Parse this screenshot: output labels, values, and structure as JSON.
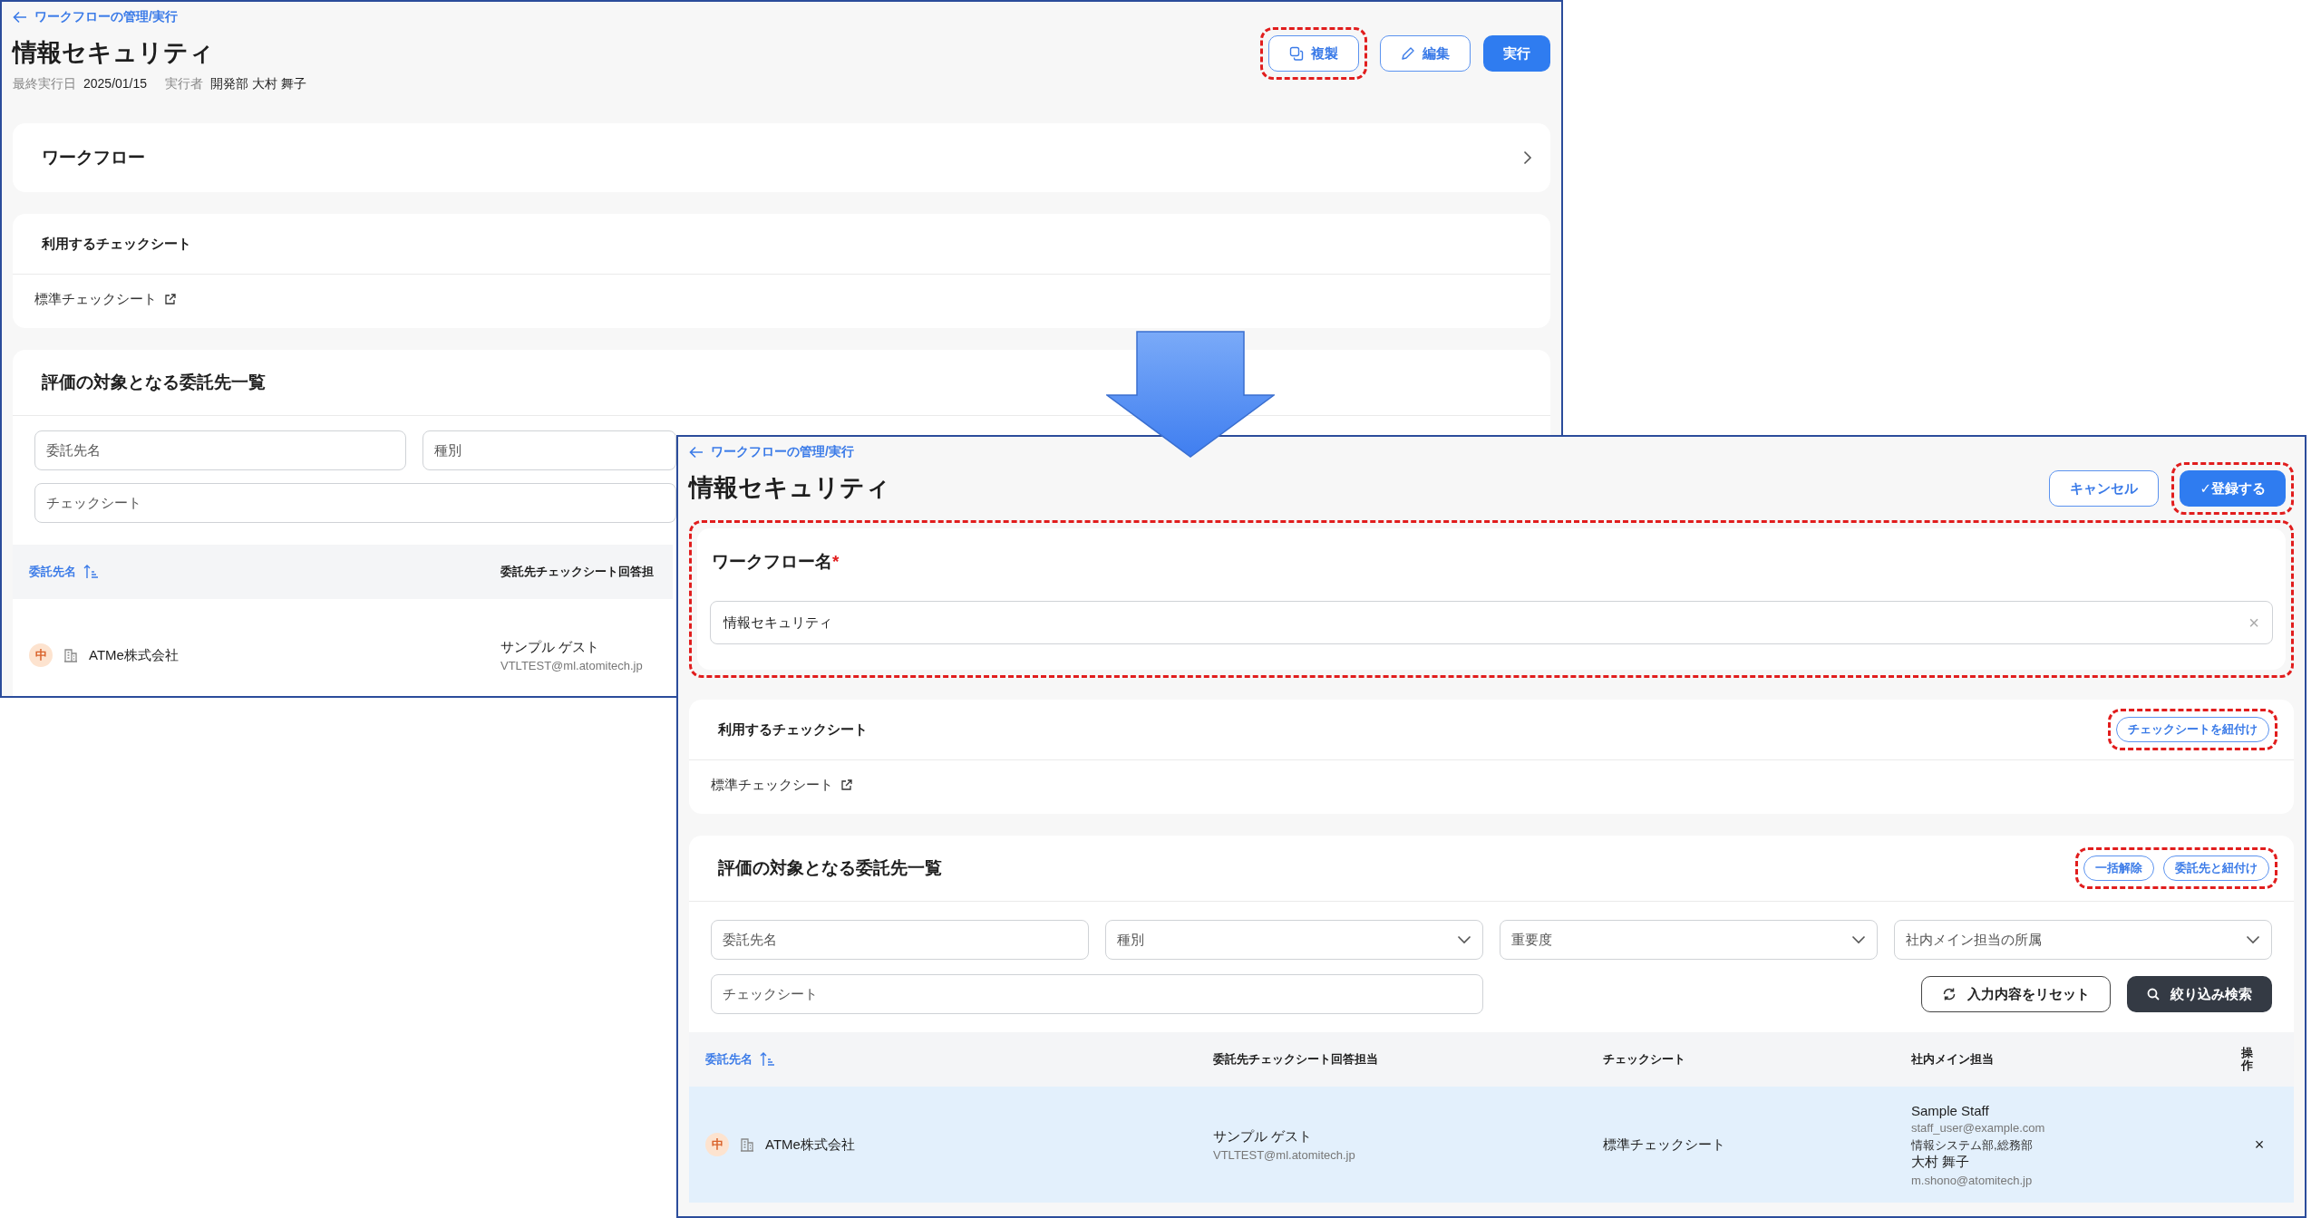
{
  "original_screen": {
    "breadcrumb": "ワークフローの管理/実行",
    "title": "情報セキュリティ",
    "meta": [
      {
        "label": "最終実行日",
        "value": "2025/01/15"
      },
      {
        "label": "実行者",
        "value": "開発部 大村 舞子"
      }
    ],
    "buttons": [
      {
        "label": "複製",
        "kind": "duplicate",
        "highlighted": true
      },
      {
        "label": "編集",
        "kind": "edit",
        "highlighted": false
      },
      {
        "label": "実行",
        "kind": "run",
        "highlighted": false
      }
    ],
    "workflow_section": {
      "title": "ワークフロー"
    },
    "checksheet_section": {
      "title": "利用するチェックシート",
      "link": "標準チェックシート"
    },
    "entrustee_section": {
      "title": "評価の対象となる委託先一覧",
      "filters": [
        {
          "placeholder": "委託先名",
          "kind": "text"
        },
        {
          "placeholder": "種別",
          "kind": "text"
        },
        {
          "placeholder": "チェックシート",
          "kind": "wide"
        }
      ],
      "table": {
        "columns": [
          {
            "label": "委託先名",
            "sorted": true
          },
          {
            "label": "委託先チェックシート回答担",
            "sorted": false
          }
        ],
        "rows": [
          {
            "selected": false,
            "priority": "中",
            "name": "ATMe株式会社",
            "responder": "サンプル ゲスト",
            "responder_email": "VTLTEST@ml.atomitech.jp"
          }
        ]
      }
    }
  },
  "edited_screen": {
    "breadcrumb": "ワークフローの管理/実行",
    "title": "情報セキュリティ",
    "buttons": [
      {
        "label": "キャンセル",
        "kind": "cancel",
        "highlighted": false
      },
      {
        "label": "✓登録する",
        "kind": "submit",
        "highlighted": true
      }
    ],
    "name_field": {
      "label": "ワークフロー名",
      "required_mark": "*",
      "value": "情報セキュリティ",
      "clear_mark": "×",
      "highlighted": true
    },
    "checksheet_section": {
      "title": "利用するチェックシート",
      "link": "標準チェックシート",
      "actions": {
        "highlighted": true,
        "buttons": [
          "チェックシートを紐付け"
        ]
      }
    },
    "entrustee_section": {
      "title": "評価の対象となる委託先一覧",
      "actions": {
        "highlighted": true,
        "buttons": [
          "一括解除",
          "委託先と紐付け"
        ]
      },
      "filters": [
        {
          "placeholder": "委託先名",
          "kind": "text"
        },
        {
          "placeholder": "種別",
          "kind": "select"
        },
        {
          "placeholder": "重要度",
          "kind": "select"
        },
        {
          "placeholder": "社内メイン担当の所属",
          "kind": "select"
        },
        {
          "placeholder": "チェックシート",
          "kind": "wide"
        }
      ],
      "filter_buttons": [
        {
          "label": "入力内容をリセット",
          "kind": "reset"
        },
        {
          "label": "絞り込み検索",
          "kind": "search"
        }
      ],
      "table": {
        "columns": [
          {
            "label": "委託先名",
            "sorted": true
          },
          {
            "label": "委託先チェックシート回答担当",
            "sorted": false
          },
          {
            "label": "チェックシート",
            "sorted": false
          },
          {
            "label": "社内メイン担当",
            "sorted": false
          },
          {
            "label": "操作",
            "sorted": false
          }
        ],
        "rows": [
          {
            "selected": true,
            "priority": "中",
            "name": "ATMe株式会社",
            "responder": "サンプル ゲスト",
            "responder_email": "VTLTEST@ml.atomitech.jp",
            "checksheet": "標準チェックシート",
            "staff": [
              {
                "name": "Sample Staff",
                "email": "staff_user@example.com",
                "dept": "情報システム部,総務部"
              },
              {
                "name": "大村 舞子",
                "email": "m.shono@atomitech.jp"
              }
            ],
            "action": "×"
          }
        ]
      }
    }
  }
}
